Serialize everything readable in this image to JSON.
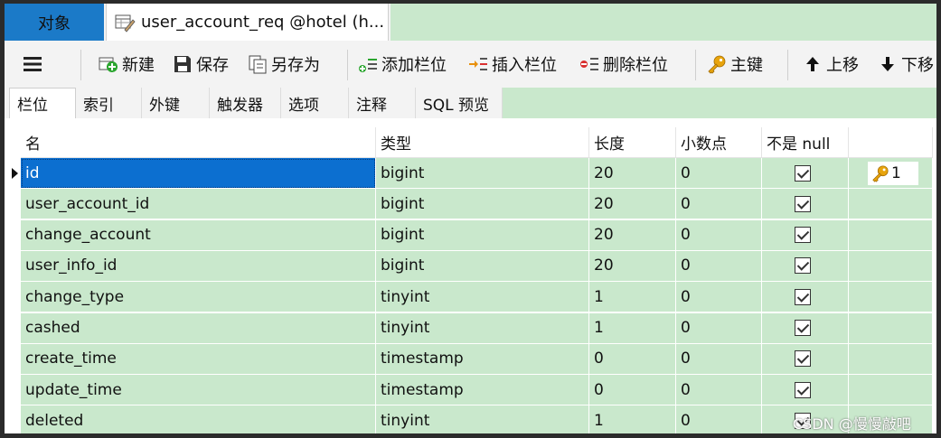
{
  "tabs": {
    "objects_label": "对象",
    "active_label": "user_account_req @hotel (h..."
  },
  "toolbar": {
    "new_label": "新建",
    "save_label": "保存",
    "save_as_label": "另存为",
    "add_field_label": "添加栏位",
    "insert_field_label": "插入栏位",
    "delete_field_label": "删除栏位",
    "primary_key_label": "主键",
    "move_up_label": "上移",
    "move_down_label": "下移"
  },
  "subtabs": [
    "栏位",
    "索引",
    "外键",
    "触发器",
    "选项",
    "注释",
    "SQL 预览"
  ],
  "columns": {
    "name": "名",
    "type": "类型",
    "length": "长度",
    "decimals": "小数点",
    "not_null": "不是 null",
    "key": ""
  },
  "rows": [
    {
      "name": "id",
      "type": "bigint",
      "length": "20",
      "decimals": "0",
      "not_null": true,
      "key": "1"
    },
    {
      "name": "user_account_id",
      "type": "bigint",
      "length": "20",
      "decimals": "0",
      "not_null": true,
      "key": ""
    },
    {
      "name": "change_account",
      "type": "bigint",
      "length": "20",
      "decimals": "0",
      "not_null": true,
      "key": ""
    },
    {
      "name": "user_info_id",
      "type": "bigint",
      "length": "20",
      "decimals": "0",
      "not_null": true,
      "key": ""
    },
    {
      "name": "change_type",
      "type": "tinyint",
      "length": "1",
      "decimals": "0",
      "not_null": true,
      "key": ""
    },
    {
      "name": "cashed",
      "type": "tinyint",
      "length": "1",
      "decimals": "0",
      "not_null": true,
      "key": ""
    },
    {
      "name": "create_time",
      "type": "timestamp",
      "length": "0",
      "decimals": "0",
      "not_null": true,
      "key": ""
    },
    {
      "name": "update_time",
      "type": "timestamp",
      "length": "0",
      "decimals": "0",
      "not_null": true,
      "key": ""
    },
    {
      "name": "deleted",
      "type": "tinyint",
      "length": "1",
      "decimals": "0",
      "not_null": true,
      "key": ""
    }
  ],
  "selected_row": 0,
  "watermark": "CSDN @慢慢敲吧",
  "colors": {
    "accent": "#1b7ac8",
    "row_bg": "#c9e8cc",
    "selection": "#0c6fd0",
    "key_icon": "#e8a40c",
    "add_icon": "#2aa52e",
    "delete_icon": "#d93030"
  }
}
